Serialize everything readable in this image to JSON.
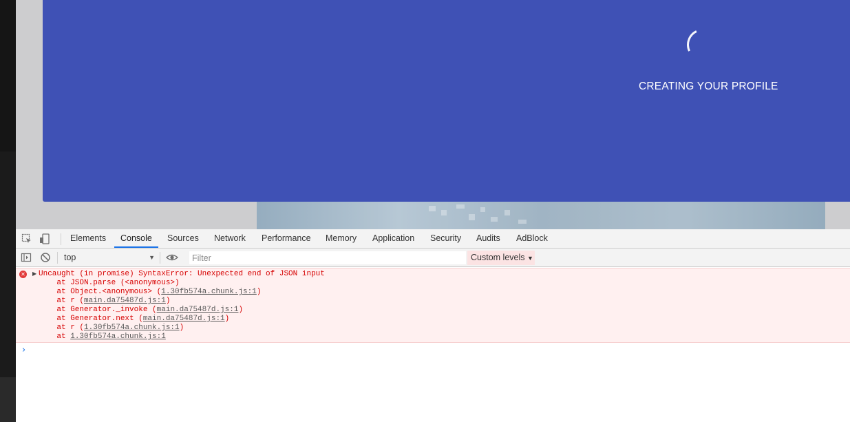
{
  "page": {
    "status_text": "CREATING YOUR PROFILE"
  },
  "devtools": {
    "tabs": [
      {
        "label": "Elements",
        "active": false
      },
      {
        "label": "Console",
        "active": true
      },
      {
        "label": "Sources",
        "active": false
      },
      {
        "label": "Network",
        "active": false
      },
      {
        "label": "Performance",
        "active": false
      },
      {
        "label": "Memory",
        "active": false
      },
      {
        "label": "Application",
        "active": false
      },
      {
        "label": "Security",
        "active": false
      },
      {
        "label": "Audits",
        "active": false
      },
      {
        "label": "AdBlock",
        "active": false
      }
    ],
    "toolbar": {
      "context": "top",
      "filter_placeholder": "Filter",
      "levels_label": "Custom levels"
    },
    "error": {
      "message": "Uncaught (in promise) SyntaxError: Unexpected end of JSON input",
      "stack": [
        {
          "prefix": "    at JSON.parse (<anonymous>)",
          "link": "",
          "suffix": ""
        },
        {
          "prefix": "    at Object.<anonymous> (",
          "link": "1.30fb574a.chunk.js:1",
          "suffix": ")"
        },
        {
          "prefix": "    at r (",
          "link": "main.da75487d.js:1",
          "suffix": ")"
        },
        {
          "prefix": "    at Generator._invoke (",
          "link": "main.da75487d.js:1",
          "suffix": ")"
        },
        {
          "prefix": "    at Generator.next (",
          "link": "main.da75487d.js:1",
          "suffix": ")"
        },
        {
          "prefix": "    at r (",
          "link": "1.30fb574a.chunk.js:1",
          "suffix": ")"
        },
        {
          "prefix": "    at ",
          "link": "1.30fb574a.chunk.js:1",
          "suffix": ""
        }
      ]
    },
    "prompt_symbol": "›"
  },
  "colors": {
    "banner": "#3f51b5",
    "error_text": "#d60000",
    "error_bg": "#fff0f0",
    "active_tab_underline": "#1a73e8"
  }
}
